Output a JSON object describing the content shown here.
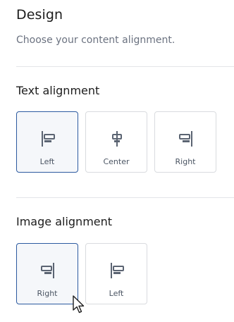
{
  "header": {
    "title": "Design",
    "subtitle": "Choose your content alignment."
  },
  "text_alignment": {
    "label": "Text alignment",
    "options": [
      {
        "label": "Left",
        "icon": "align-left-icon",
        "selected": true
      },
      {
        "label": "Center",
        "icon": "align-center-icon",
        "selected": false
      },
      {
        "label": "Right",
        "icon": "align-right-icon",
        "selected": false
      }
    ]
  },
  "image_alignment": {
    "label": "Image alignment",
    "options": [
      {
        "label": "Right",
        "icon": "align-right-icon",
        "selected": true
      },
      {
        "label": "Left",
        "icon": "align-left-icon",
        "selected": false
      }
    ]
  },
  "colors": {
    "selected_border": "#2c5aa0",
    "icon": "#5b6472"
  },
  "cursor": {
    "icon": "mouse-pointer-icon"
  }
}
